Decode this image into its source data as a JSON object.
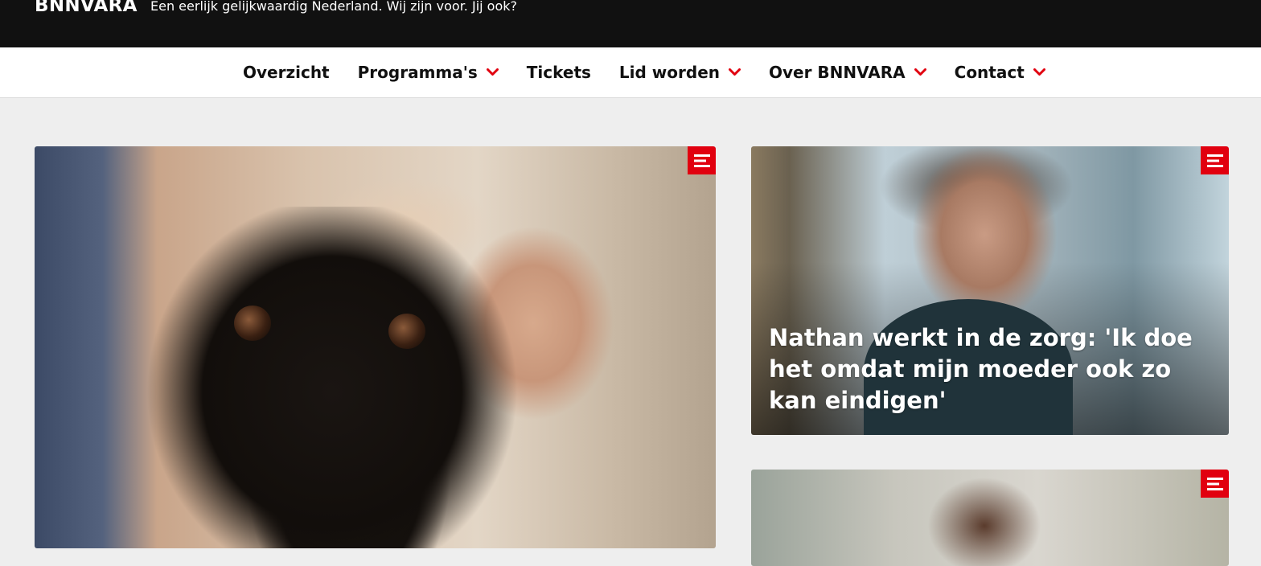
{
  "header": {
    "logo_text": "BNNVARA",
    "tagline": "Een eerlijk gelijkwaardig Nederland. Wij zijn voor. Jij ook?"
  },
  "nav": {
    "items": [
      {
        "label": "Overzicht",
        "has_dropdown": false
      },
      {
        "label": "Programma's",
        "has_dropdown": true
      },
      {
        "label": "Tickets",
        "has_dropdown": false
      },
      {
        "label": "Lid worden",
        "has_dropdown": true
      },
      {
        "label": "Over BNNVARA",
        "has_dropdown": true
      },
      {
        "label": "Contact",
        "has_dropdown": true
      }
    ],
    "chevron_icon": "chevron-down-icon"
  },
  "articles": [
    {
      "title": "",
      "badge_icon": "article-icon"
    },
    {
      "title": "Nathan werkt in de zorg: 'Ik doe het omdat mijn moeder ook zo kan eindigen'",
      "badge_icon": "article-icon"
    },
    {
      "title": "",
      "badge_icon": "article-icon"
    }
  ],
  "colors": {
    "accent": "#e1000f",
    "topbar_bg": "#111111",
    "nav_bg": "#ffffff",
    "page_bg": "#eeeeee"
  }
}
